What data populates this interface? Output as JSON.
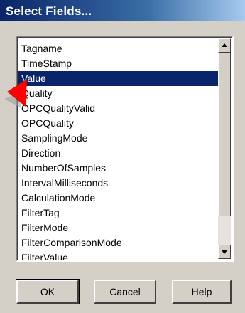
{
  "window": {
    "title": "Select Fields..."
  },
  "fields": {
    "items": [
      "Tagname",
      "TimeStamp",
      "Value",
      "Quality",
      "OPCQualityValid",
      "OPCQuality",
      "SamplingMode",
      "Direction",
      "NumberOfSamples",
      "IntervalMilliseconds",
      "CalculationMode",
      "FilterTag",
      "FilterMode",
      "FilterComparisonMode",
      "FilterValue"
    ],
    "selected": "Value"
  },
  "buttons": {
    "ok": "OK",
    "cancel": "Cancel",
    "help": "Help"
  },
  "colors": {
    "dialog_bg": "#d4d0c8",
    "title_bar": "#0a246a",
    "selection": "#0a246a",
    "pointer": "#ff0000"
  },
  "icons": {
    "pointer": "red-arrow-pointer-icon",
    "scroll_up": "scroll-up-icon",
    "scroll_down": "scroll-down-icon"
  }
}
